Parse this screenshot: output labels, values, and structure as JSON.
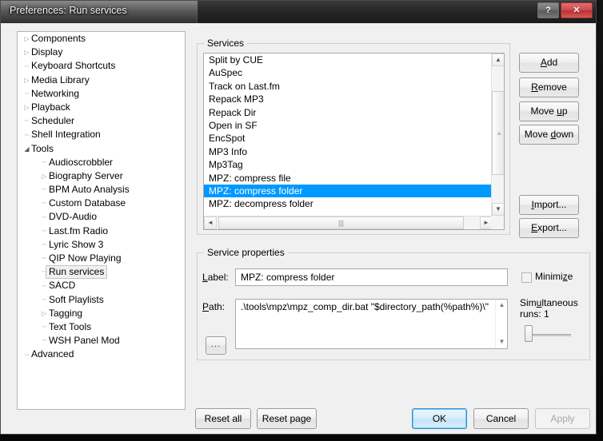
{
  "window": {
    "title": "Preferences: Run services",
    "help_button": "?",
    "close_button": "✕"
  },
  "tree": {
    "items": [
      {
        "label": "Components",
        "depth": 0,
        "marker": "collapsed"
      },
      {
        "label": "Display",
        "depth": 0,
        "marker": "collapsed"
      },
      {
        "label": "Keyboard Shortcuts",
        "depth": 0,
        "marker": "leaf"
      },
      {
        "label": "Media Library",
        "depth": 0,
        "marker": "collapsed"
      },
      {
        "label": "Networking",
        "depth": 0,
        "marker": "leaf"
      },
      {
        "label": "Playback",
        "depth": 0,
        "marker": "collapsed"
      },
      {
        "label": "Scheduler",
        "depth": 0,
        "marker": "leaf"
      },
      {
        "label": "Shell Integration",
        "depth": 0,
        "marker": "leaf"
      },
      {
        "label": "Tools",
        "depth": 0,
        "marker": "expanded"
      },
      {
        "label": "Audioscrobbler",
        "depth": 1,
        "marker": "leaf"
      },
      {
        "label": "Biography Server",
        "depth": 1,
        "marker": "collapsed"
      },
      {
        "label": "BPM Auto Analysis",
        "depth": 1,
        "marker": "leaf"
      },
      {
        "label": "Custom Database",
        "depth": 1,
        "marker": "leaf"
      },
      {
        "label": "DVD-Audio",
        "depth": 1,
        "marker": "leaf"
      },
      {
        "label": "Last.fm Radio",
        "depth": 1,
        "marker": "leaf"
      },
      {
        "label": "Lyric Show 3",
        "depth": 1,
        "marker": "leaf"
      },
      {
        "label": "QIP Now Playing",
        "depth": 1,
        "marker": "leaf"
      },
      {
        "label": "Run services",
        "depth": 1,
        "marker": "leaf",
        "selected": true
      },
      {
        "label": "SACD",
        "depth": 1,
        "marker": "leaf"
      },
      {
        "label": "Soft Playlists",
        "depth": 1,
        "marker": "leaf"
      },
      {
        "label": "Tagging",
        "depth": 1,
        "marker": "collapsed"
      },
      {
        "label": "Text Tools",
        "depth": 1,
        "marker": "leaf"
      },
      {
        "label": "WSH Panel Mod",
        "depth": 1,
        "marker": "leaf"
      },
      {
        "label": "Advanced",
        "depth": 0,
        "marker": "leaf"
      }
    ]
  },
  "services": {
    "legend": "Services",
    "items": [
      "Split by CUE",
      "AuSpec",
      "Track on Last.fm",
      "Repack MP3",
      "Repack Dir",
      "Open in SF",
      "EncSpot",
      "MP3 Info",
      "Mp3Tag",
      "MPZ: compress file",
      "MPZ: compress folder",
      "MPZ: decompress folder"
    ],
    "selected_index": 10,
    "selected_value": "MPZ: compress folder"
  },
  "side_buttons": [
    {
      "label": "Add",
      "accel": "A",
      "name": "add-button"
    },
    {
      "label": "Remove",
      "accel": "R",
      "name": "remove-button"
    },
    {
      "label": "Move up",
      "accel": "u",
      "name": "move-up-button"
    },
    {
      "label": "Move down",
      "accel": "d",
      "name": "move-down-button"
    },
    {
      "label": "Import...",
      "accel": "I",
      "name": "import-button"
    },
    {
      "label": "Export...",
      "accel": "E",
      "name": "export-button"
    }
  ],
  "properties": {
    "legend": "Service properties",
    "label_caption": "Label:",
    "label_accel": "L",
    "label_value": "MPZ: compress folder",
    "path_caption": "Path:",
    "path_accel": "P",
    "path_value": ".\\tools\\mpz\\mpz_comp_dir.bat \"$directory_path(%path%)\\\"",
    "browse_button": "...",
    "minimize_label": "Minimize",
    "minimize_accel": "z",
    "minimize_checked": false,
    "simultaneous_label": "Simultaneous runs: 1",
    "simultaneous_accel": "u",
    "simultaneous_value": 1
  },
  "footer": {
    "reset_all": "Reset all",
    "reset_page": "Reset page",
    "ok": "OK",
    "cancel": "Cancel",
    "apply": "Apply",
    "apply_enabled": false
  },
  "colors": {
    "selection": "#0099ff",
    "default_button_border": "#2c8fd6",
    "window_face": "#f0f0f0",
    "close_button": "#cf4a4a"
  },
  "icons": {
    "scroll_up": "▲",
    "scroll_down": "▼",
    "scroll_left": "◄",
    "scroll_right": "►",
    "collapsed_arrow": "▷",
    "expanded_arrow": "◢",
    "grip": "▮"
  }
}
